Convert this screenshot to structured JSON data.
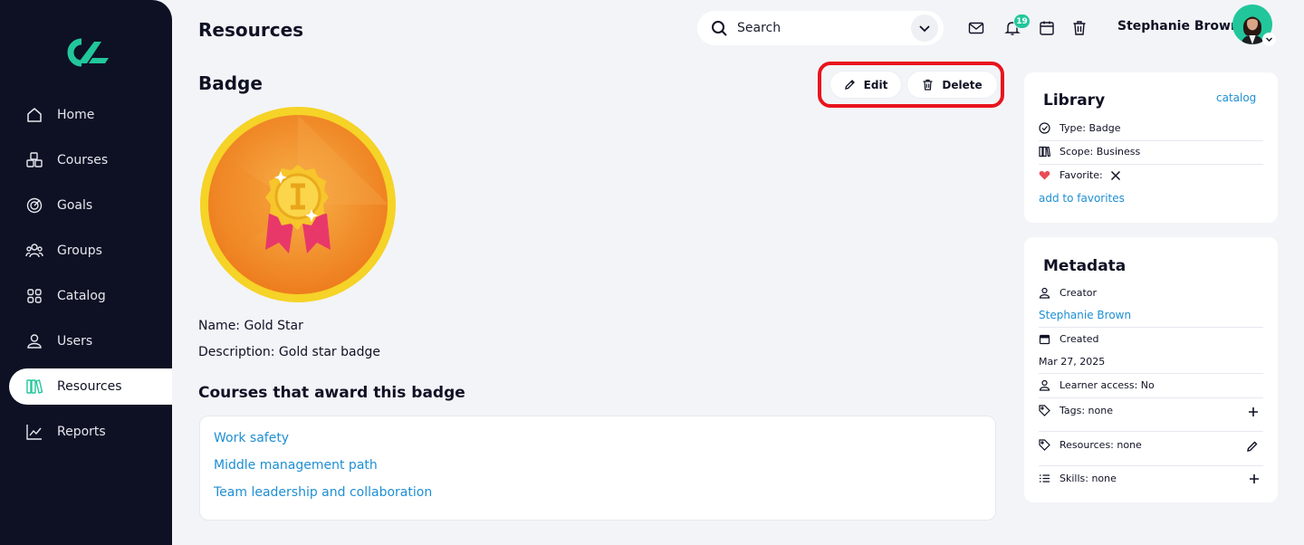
{
  "sidebar": {
    "logo": "brand-logo",
    "items": [
      {
        "label": "Home",
        "icon": "home-icon"
      },
      {
        "label": "Courses",
        "icon": "cubes-icon"
      },
      {
        "label": "Goals",
        "icon": "target-icon"
      },
      {
        "label": "Groups",
        "icon": "users-group-icon"
      },
      {
        "label": "Catalog",
        "icon": "grid-icon"
      },
      {
        "label": "Users",
        "icon": "user-icon"
      },
      {
        "label": "Resources",
        "icon": "books-icon",
        "active": true
      },
      {
        "label": "Reports",
        "icon": "chart-line-icon"
      }
    ]
  },
  "header": {
    "title": "Resources",
    "search_placeholder": "Search",
    "notifications_count": "19",
    "user_name": "Stephanie Brown"
  },
  "main": {
    "heading": "Badge",
    "edit_label": "Edit",
    "delete_label": "Delete",
    "name_line": "Name: Gold Star",
    "description_line": "Description: Gold star badge",
    "courses_title": "Courses that award this badge",
    "courses": [
      "Work safety",
      "Middle management path",
      "Team leadership and collaboration"
    ]
  },
  "library": {
    "title": "Library",
    "catalog_link": "catalog",
    "type": "Type: Badge",
    "scope": "Scope: Business",
    "favorite": "Favorite:",
    "add_favorites": "add to favorites"
  },
  "metadata": {
    "title": "Metadata",
    "creator_label": "Creator",
    "creator_value": "Stephanie Brown",
    "created_label": "Created",
    "created_value": "Mar 27, 2025",
    "learner_access": "Learner access: No",
    "tags": "Tags: none",
    "resources": "Resources: none",
    "skills": "Skills:  none"
  },
  "colors": {
    "sidebar_bg": "#0e1124",
    "accent": "#21c79b",
    "link": "#1e8fd3",
    "highlight": "#e8141c"
  }
}
